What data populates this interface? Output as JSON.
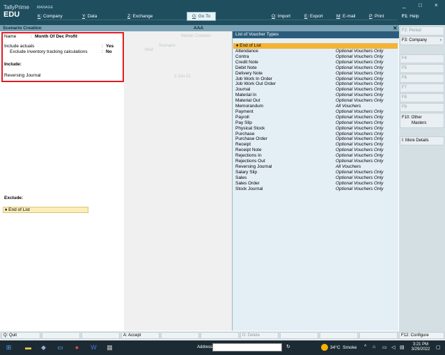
{
  "app": {
    "brand_line1": "TallyPrime",
    "brand_line2": "EDU",
    "manage_label": "MANAGE",
    "menu": [
      {
        "key": "K",
        "label": ": Company"
      },
      {
        "key": "Y",
        "label": ": Data"
      },
      {
        "key": "Z",
        "label": ": Exchange"
      }
    ],
    "goto": {
      "key": "G",
      "label": ": Go To"
    },
    "right_menu": [
      {
        "key": "O",
        "label": ": Import"
      },
      {
        "key": "E",
        "label": ": Export"
      },
      {
        "key": "M",
        "label": ": E-mail"
      },
      {
        "key": "P",
        "label": ": Print"
      },
      {
        "key": "F1",
        "label": ": Help"
      }
    ],
    "window_controls": [
      "_",
      "□",
      "×"
    ]
  },
  "titlebar": {
    "left": "Scenario Creation",
    "center": "AAA",
    "close": "✕"
  },
  "form": {
    "name_label": "Name",
    "name_sep": ":",
    "name_value": "Month Of Dec Profit",
    "include_actuals_label": "Include actuals",
    "include_actuals_value": "Yes",
    "exclude_inv_label": "Exclude inventory tracking calculations",
    "exclude_inv_value": "No",
    "colon": ":",
    "include_heading": "Include:",
    "include_item": "Reversing Journal",
    "exclude_heading": "Exclude:",
    "exclude_end": "End of List"
  },
  "ghost": {
    "master_creation": "Master Creation",
    "scenario": "Scenario",
    "mod": "Mod",
    "date": "2-Jun-21"
  },
  "voucher_list": {
    "title": "List of Voucher Types",
    "end_of_list": "End of List",
    "items": [
      {
        "name": "Attendance",
        "desc": "Optional Vouchers Only"
      },
      {
        "name": "Contra",
        "desc": "Optional Vouchers Only"
      },
      {
        "name": "Credit Note",
        "desc": "Optional Vouchers Only"
      },
      {
        "name": "Debit Note",
        "desc": "Optional Vouchers Only"
      },
      {
        "name": "Delivery Note",
        "desc": "Optional Vouchers Only"
      },
      {
        "name": "Job Work In Order",
        "desc": "Optional Vouchers Only"
      },
      {
        "name": "Job Work Out Order",
        "desc": "Optional Vouchers Only"
      },
      {
        "name": "Journal",
        "desc": "Optional Vouchers Only"
      },
      {
        "name": "Material In",
        "desc": "Optional Vouchers Only"
      },
      {
        "name": "Material Out",
        "desc": "Optional Vouchers Only"
      },
      {
        "name": "Memorandum",
        "desc": "All Vouchers"
      },
      {
        "name": "Payment",
        "desc": "Optional Vouchers Only"
      },
      {
        "name": "Payroll",
        "desc": "Optional Vouchers Only"
      },
      {
        "name": "Pay Slip",
        "desc": "Optional Vouchers Only"
      },
      {
        "name": "Physical Stock",
        "desc": "Optional Vouchers Only"
      },
      {
        "name": "Purchase",
        "desc": "Optional Vouchers Only"
      },
      {
        "name": "Purchase Order",
        "desc": "Optional Vouchers Only"
      },
      {
        "name": "Receipt",
        "desc": "Optional Vouchers Only"
      },
      {
        "name": "Receipt Note",
        "desc": "Optional Vouchers Only"
      },
      {
        "name": "Rejections In",
        "desc": "Optional Vouchers Only"
      },
      {
        "name": "Rejections Out",
        "desc": "Optional Vouchers Only"
      },
      {
        "name": "Reversing Journal",
        "desc": "All Vouchers"
      },
      {
        "name": "Salary Slip",
        "desc": "Optional Vouchers Only"
      },
      {
        "name": "Sales",
        "desc": "Optional Vouchers Only"
      },
      {
        "name": "Sales Order",
        "desc": "Optional Vouchers Only"
      },
      {
        "name": "Stock Journal",
        "desc": "Optional Vouchers Only"
      }
    ]
  },
  "right_buttons": {
    "f2": "F2: Period",
    "f3": "F3: Company",
    "f4": "F4",
    "f5": "F5",
    "f6": "F6",
    "f7": "F7",
    "f8": "F8",
    "f9": "F9",
    "f10_line1": "F10: Other",
    "f10_line2": "Masters",
    "more": "I: More Details"
  },
  "bottom_buttons": {
    "quit": "Q: Quit",
    "accept": "A: Accept",
    "delete": "D: Delete",
    "f12": "F12: Configure"
  },
  "taskbar": {
    "address_label": "Address",
    "temperature": "34°C",
    "weather": "Smoke",
    "time": "3:21 PM",
    "date": "3/29/2022"
  }
}
